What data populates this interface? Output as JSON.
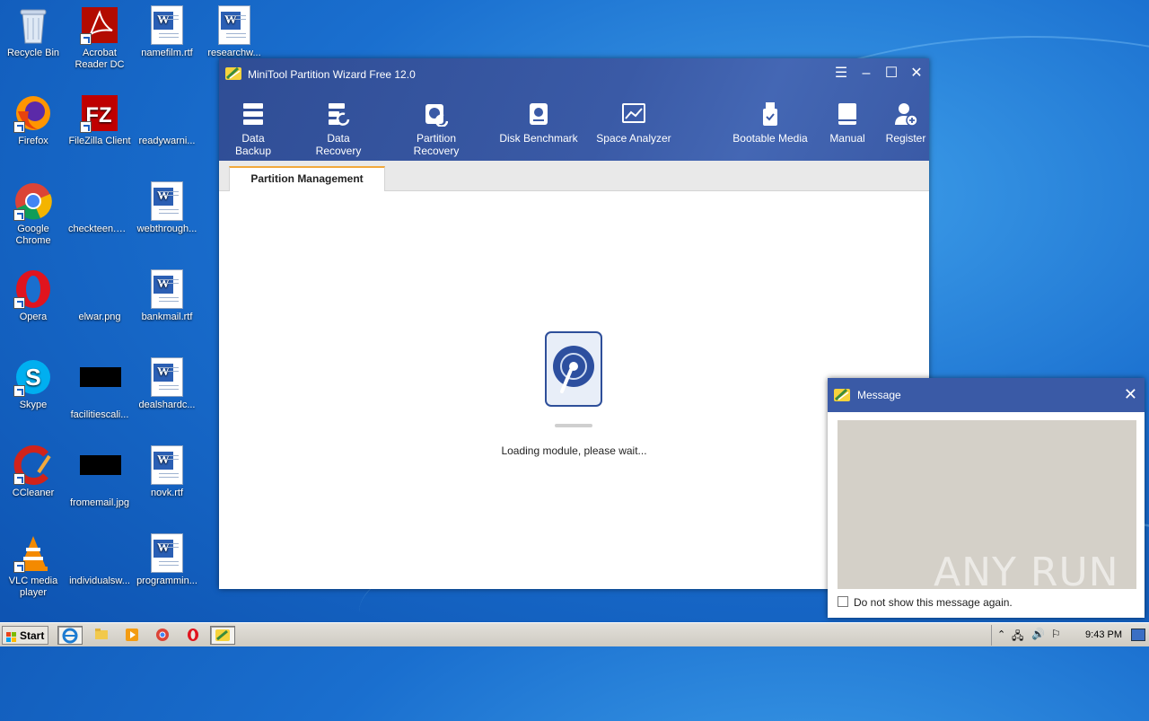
{
  "desktop_icons": [
    {
      "label": "Recycle Bin"
    },
    {
      "label": "Acrobat Reader DC"
    },
    {
      "label": "namefilm.rtf"
    },
    {
      "label": "researchw..."
    },
    {
      "label": "Firefox"
    },
    {
      "label": "FileZilla Client"
    },
    {
      "label": "readywarni..."
    },
    {
      "label": "Google Chrome"
    },
    {
      "label": "checkteen.png"
    },
    {
      "label": "webthrough..."
    },
    {
      "label": "Opera"
    },
    {
      "label": "elwar.png"
    },
    {
      "label": "bankmail.rtf"
    },
    {
      "label": "Skype"
    },
    {
      "label": "facilitiescali..."
    },
    {
      "label": "dealshardc..."
    },
    {
      "label": "CCleaner"
    },
    {
      "label": "fromemail.jpg"
    },
    {
      "label": "novk.rtf"
    },
    {
      "label": "VLC media player"
    },
    {
      "label": "individualsw..."
    },
    {
      "label": "programmin..."
    }
  ],
  "window": {
    "title": "MiniTool Partition Wizard Free 12.0",
    "toolbar": [
      {
        "label": "Data Backup",
        "icon": "data-backup-icon"
      },
      {
        "label": "Data Recovery",
        "icon": "data-recovery-icon"
      },
      {
        "label": "Partition Recovery",
        "icon": "partition-recovery-icon"
      },
      {
        "label": "Disk Benchmark",
        "icon": "disk-benchmark-icon"
      },
      {
        "label": "Space Analyzer",
        "icon": "space-analyzer-icon"
      },
      {
        "label": "Bootable Media",
        "icon": "bootable-media-icon"
      },
      {
        "label": "Manual",
        "icon": "manual-icon"
      },
      {
        "label": "Register",
        "icon": "register-icon"
      }
    ],
    "tab": "Partition Management",
    "loading_text": "Loading module, please wait..."
  },
  "message_dialog": {
    "title": "Message",
    "checkbox_label": "Do not show this message again."
  },
  "watermark": "ANY RUN",
  "taskbar": {
    "start_label": "Start",
    "clock": "9:43 PM"
  },
  "colors": {
    "header_blue": "#3a5aa6",
    "tab_accent": "#f2a93b",
    "desktop_blue": "#1a6fcf"
  }
}
